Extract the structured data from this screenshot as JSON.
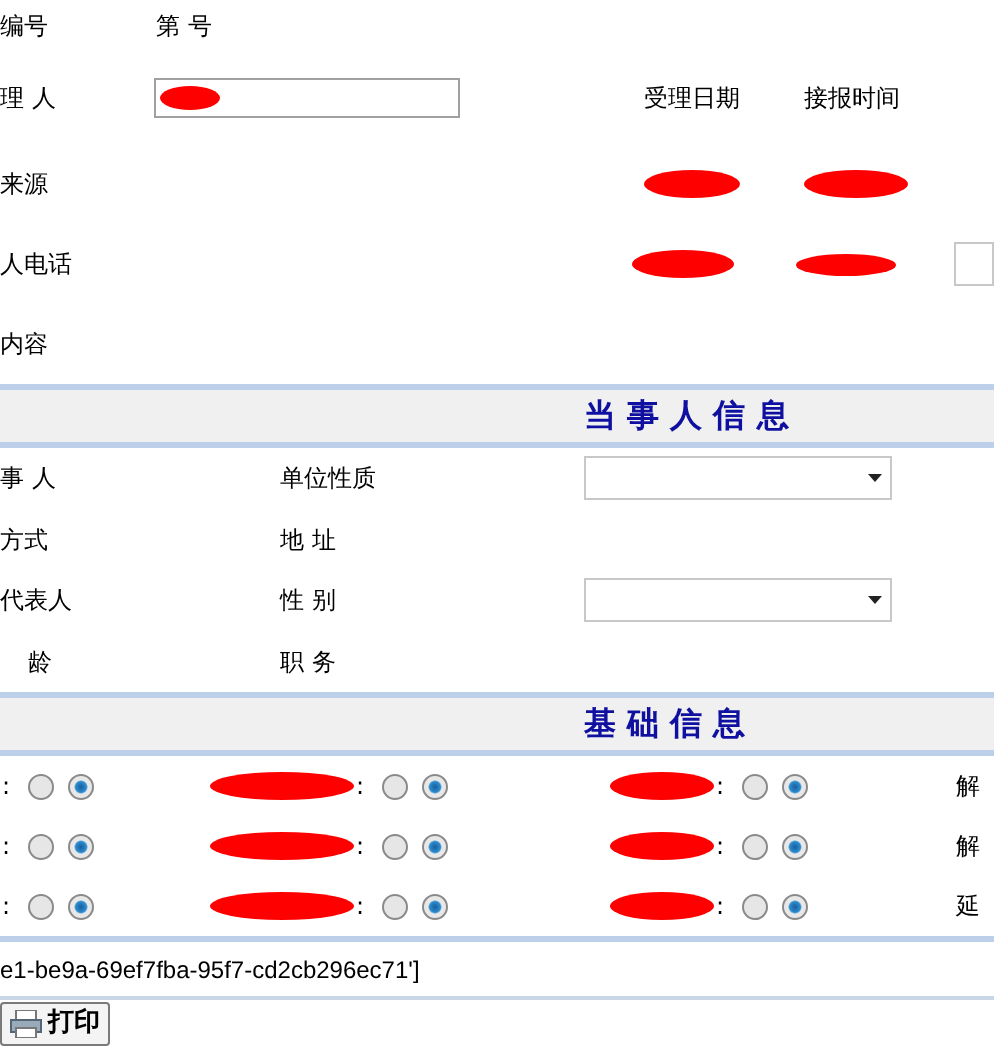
{
  "case": {
    "number_label": "编号",
    "number_value": "第 号",
    "handler_label": "理 人",
    "date_label": "受理日期",
    "time_label": "接报时间",
    "source_label": "来源",
    "phone_label": "人电话",
    "content_label": "内容"
  },
  "party": {
    "title": "当 事 人 信 息",
    "rows": [
      {
        "label": "事 人",
        "label_2": "单位性质",
        "kind": "select"
      },
      {
        "label": "方式",
        "label_2": "地 址",
        "kind": "text"
      },
      {
        "label": "代表人",
        "label_2": "性 别",
        "kind": "select"
      },
      {
        "label": "龄",
        "label_2": "职 务",
        "kind": "text"
      }
    ]
  },
  "basic": {
    "title": "基 础 信 息",
    "rows": [
      {
        "groups": [
          {
            "label": ":",
            "options": [
              {
                "selected": false
              },
              {
                "selected": true
              }
            ]
          },
          {
            "label": ":",
            "options": [
              {
                "selected": false
              },
              {
                "selected": true
              }
            ]
          },
          {
            "label": ":",
            "options": [
              {
                "selected": false
              },
              {
                "selected": true
              }
            ]
          }
        ],
        "trailing": "解"
      },
      {
        "groups": [
          {
            "label": ":",
            "options": [
              {
                "selected": false
              },
              {
                "selected": true
              }
            ]
          },
          {
            "label": ":",
            "options": [
              {
                "selected": false
              },
              {
                "selected": true
              }
            ]
          },
          {
            "label": ":",
            "options": [
              {
                "selected": false
              },
              {
                "selected": true
              }
            ]
          }
        ],
        "trailing": "解"
      },
      {
        "groups": [
          {
            "label": ":",
            "options": [
              {
                "selected": false
              },
              {
                "selected": true
              }
            ]
          },
          {
            "label": ":",
            "options": [
              {
                "selected": false
              },
              {
                "selected": true
              }
            ]
          },
          {
            "label": ":",
            "options": [
              {
                "selected": false
              },
              {
                "selected": true
              }
            ]
          }
        ],
        "trailing": "延"
      }
    ]
  },
  "footer_id": "e1-be9a-69ef7fba-95f7-cd2cb296ec71']",
  "print_button": "打印"
}
